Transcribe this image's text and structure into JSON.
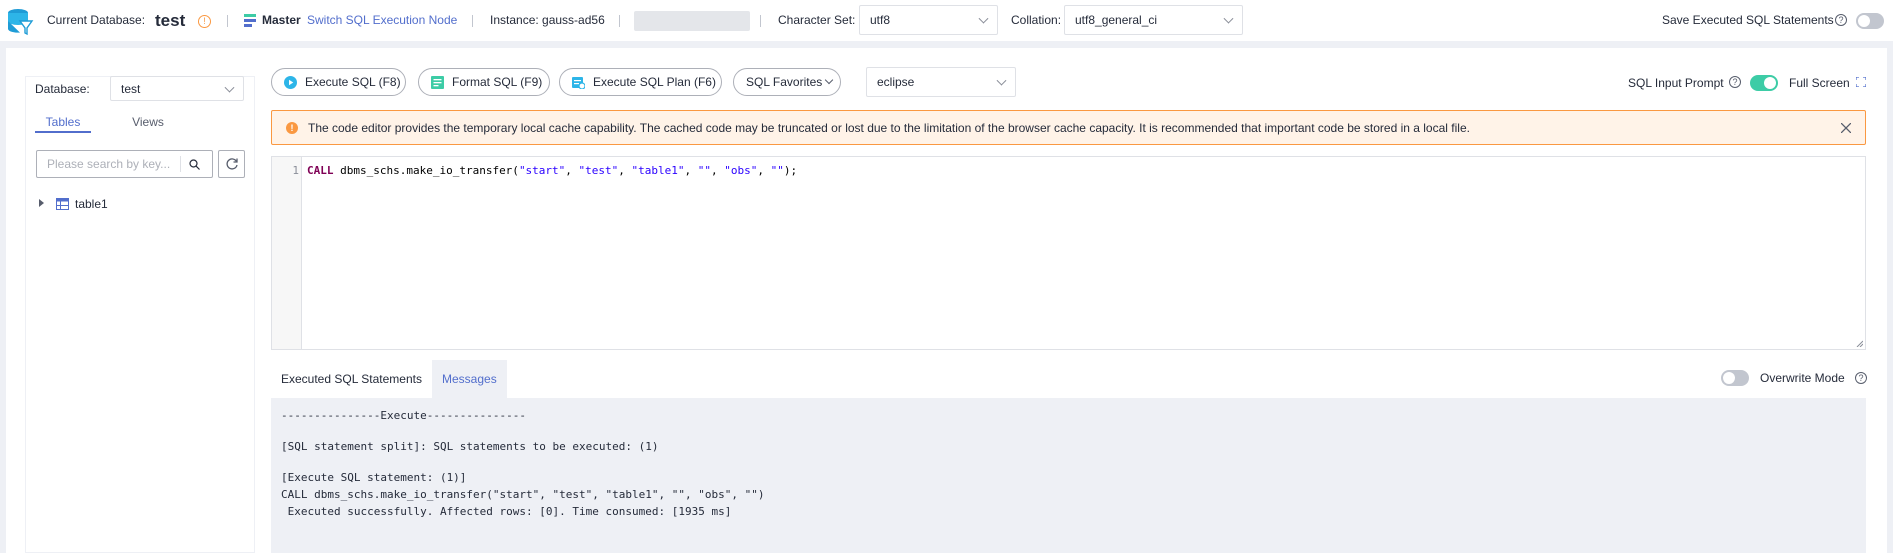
{
  "topbar": {
    "current_database_label": "Current Database:",
    "current_database_value": "test",
    "master_label": "Master",
    "switch_node_link": "Switch SQL Execution Node",
    "instance_label": "Instance: gauss-ad56",
    "charset_label": "Character Set:",
    "charset_value": "utf8",
    "collation_label": "Collation:",
    "collation_value": "utf8_general_ci",
    "save_statements_label": "Save Executed SQL Statements"
  },
  "sidebar": {
    "database_label": "Database:",
    "database_value": "test",
    "tabs": [
      {
        "label": "Tables",
        "active": true
      },
      {
        "label": "Views",
        "active": false
      }
    ],
    "search_placeholder": "Please search by key...",
    "tree": [
      {
        "label": "table1"
      }
    ]
  },
  "toolbar": {
    "execute_label": "Execute SQL (F8)",
    "format_label": "Format SQL (F9)",
    "plan_label": "Execute SQL Plan (F6)",
    "favorites_label": "SQL Favorites",
    "theme_value": "eclipse",
    "input_prompt_label": "SQL Input Prompt",
    "fullscreen_label": "Full Screen"
  },
  "warning": {
    "text": "The code editor provides the temporary local cache capability. The cached code may be truncated or lost due to the limitation of the browser cache capacity. It is recommended that important code be stored in a local file."
  },
  "editor": {
    "line_number": "1",
    "tokens": {
      "keyword": "CALL",
      "func": " dbms_schs.make_io_transfer(",
      "s1": "\"start\"",
      "c1": ", ",
      "s2": "\"test\"",
      "c2": ", ",
      "s3": "\"table1\"",
      "c3": ", ",
      "s4": "\"\"",
      "c4": ", ",
      "s5": "\"obs\"",
      "c5": ", ",
      "s6": "\"\"",
      "end": ");"
    }
  },
  "output": {
    "tabs": [
      {
        "label": "Executed SQL Statements",
        "active": false
      },
      {
        "label": "Messages",
        "active": true
      }
    ],
    "overwrite_label": "Overwrite Mode",
    "lines": [
      "---------------Execute---------------",
      "[SQL statement split]: SQL statements to be executed: (1)",
      "[Execute SQL statement: (1)]",
      "CALL dbms_schs.make_io_transfer(\"start\", \"test\", \"table1\", \"\", \"obs\", \"\")",
      " Executed successfully. Affected rows: [0]. Time consumed: [1935 ms]"
    ]
  },
  "colors": {
    "accent": "#526ecc",
    "toggle_on": "#3dcca6",
    "warning_border": "#fa9841",
    "warning_bg": "#fff3e8"
  }
}
